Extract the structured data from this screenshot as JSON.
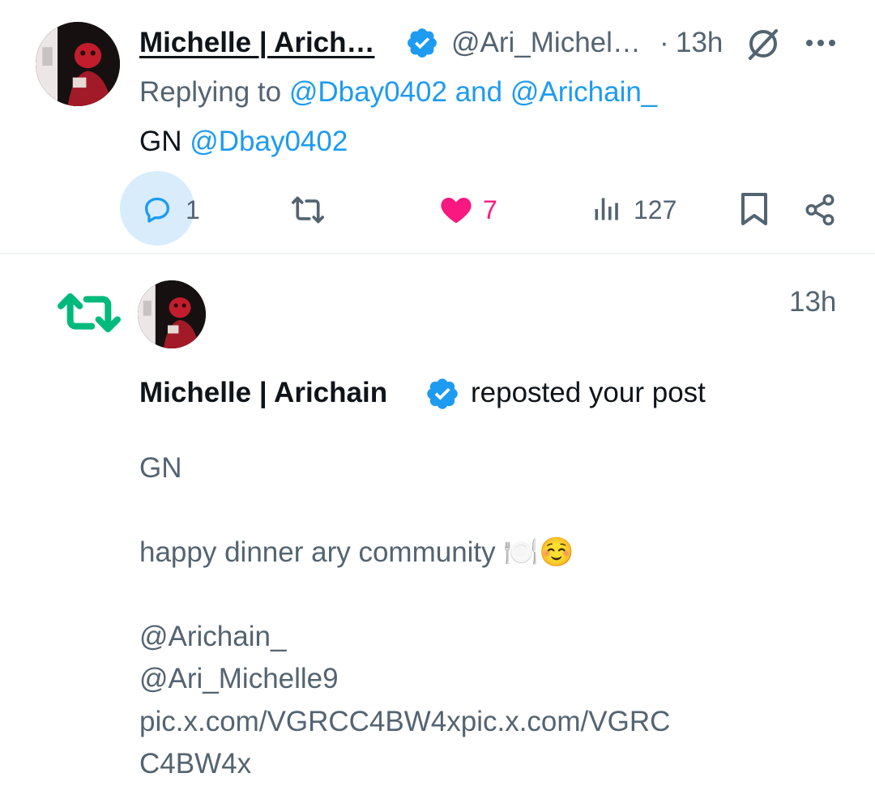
{
  "reply_post": {
    "author_name": "Michelle | Arich…",
    "author_handle": "@Ari_Michel…",
    "separator": "·",
    "time": "13h",
    "replying_prefix": "Replying to",
    "replying_user1": "@Dbay0402",
    "replying_and": "and",
    "replying_user2": "@Arichain_",
    "body_prefix": "GN",
    "body_mention": "@Dbay0402",
    "actions": {
      "replies": "1",
      "likes": "7",
      "views": "127"
    }
  },
  "repost_notification": {
    "time": "13h",
    "reposter_name": "Michelle | Arichain",
    "action_text": "reposted your post",
    "post_lines": {
      "line1": "GN",
      "line2": "happy dinner ary community",
      "line2_emoji": "🍽️☺️",
      "line3": "@Arichain_",
      "line4": "@Ari_Michelle9",
      "line5": "pic.x.com/VGRCC4BW4xpic.x.com/VGRC",
      "line6": "C4BW4x"
    }
  },
  "colors": {
    "accent": "#1d9bf0",
    "like": "#f91880",
    "repost": "#00ba7c",
    "muted": "#536471",
    "reply_highlight": "#d9ecfb"
  },
  "icons": [
    "verified-badge-icon",
    "grok-icon",
    "more-icon",
    "reply-icon",
    "repost-icon",
    "like-icon",
    "views-icon",
    "bookmark-icon",
    "share-icon"
  ]
}
